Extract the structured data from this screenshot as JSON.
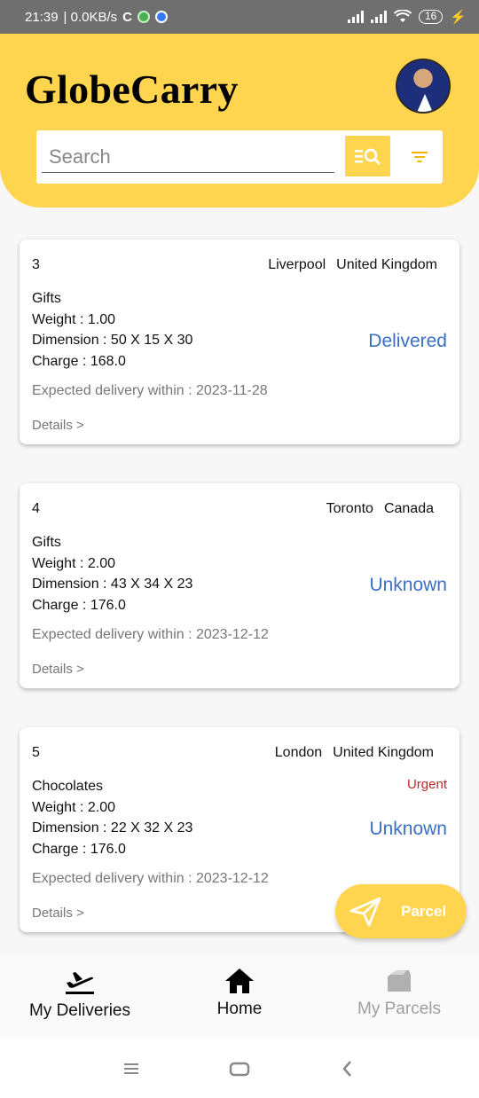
{
  "status_bar": {
    "time": "21:39",
    "speed": "| 0.0KB/s",
    "battery": "16"
  },
  "header": {
    "title": "GlobeCarry",
    "search_placeholder": "Search"
  },
  "deliveries": [
    {
      "id": "3",
      "city": "Liverpool",
      "country": "United Kingdom",
      "item": "Gifts",
      "weight": "Weight : 1.00",
      "dimension": "Dimension : 50 X 15 X 30",
      "charge": "Charge : 168.0",
      "status": "Delivered",
      "urgent": "",
      "expected": "Expected delivery within : 2023-11-28",
      "details": "Details >"
    },
    {
      "id": "4",
      "city": "Toronto",
      "country": "Canada",
      "item": "Gifts",
      "weight": "Weight : 2.00",
      "dimension": "Dimension : 43 X 34 X 23",
      "charge": "Charge : 176.0",
      "status": "Unknown",
      "urgent": "",
      "expected": "Expected delivery within : 2023-12-12",
      "details": "Details >"
    },
    {
      "id": "5",
      "city": "London",
      "country": "United Kingdom",
      "item": "Chocolates",
      "weight": "Weight : 2.00",
      "dimension": "Dimension : 22 X 32 X 23",
      "charge": "Charge : 176.0",
      "status": "Unknown",
      "urgent": "Urgent",
      "expected": "Expected delivery within : 2023-12-12",
      "details": "Details >"
    }
  ],
  "fab": {
    "label": "Parcel",
    "icon": "paper-plane-icon"
  },
  "bottom_nav": [
    {
      "label": "My Deliveries",
      "icon": "airplane-takeoff-icon"
    },
    {
      "label": "Home",
      "icon": "home-icon"
    },
    {
      "label": "My Parcels",
      "icon": "parcel-icon"
    }
  ],
  "colors": {
    "accent": "#ffd54f",
    "status_blue": "#3a6fc4",
    "urgent_red": "#c62828"
  }
}
